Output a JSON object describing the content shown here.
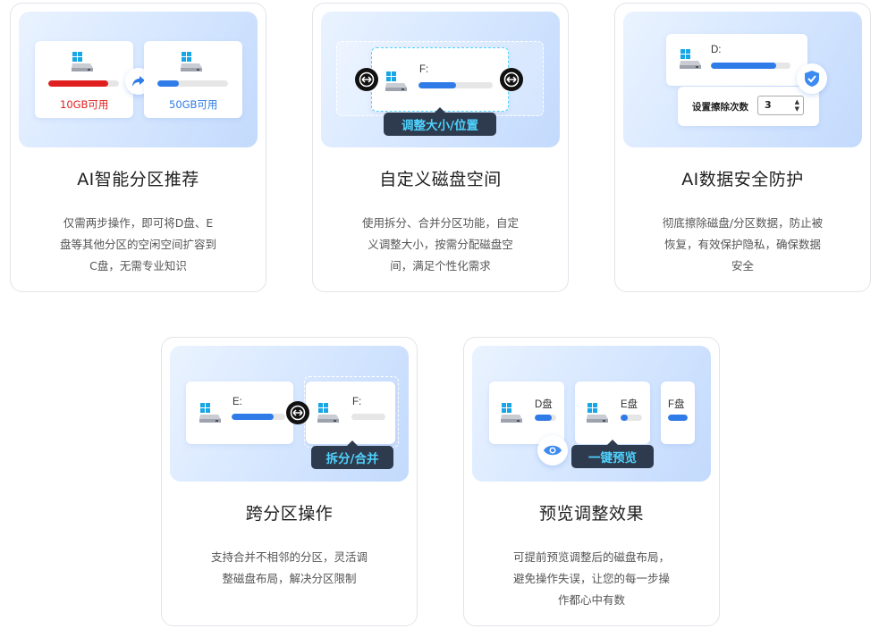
{
  "cards": [
    {
      "title": "AI智能分区推荐",
      "desc": "仅需两步操作，即可将D盘、E盘等其他分区的空闲空间扩容到C盘，无需专业知识",
      "left_caption": "10GB可用",
      "right_caption": "50GB可用",
      "left_fill": 0.85,
      "right_fill": 0.3
    },
    {
      "title": "自定义磁盘空间",
      "desc": "使用拆分、合并分区功能，自定义调整大小，按需分配磁盘空间，满足个性化需求",
      "drive_label": "F:",
      "tag": "调整大小/位置",
      "fill": 0.5
    },
    {
      "title": "AI数据安全防护",
      "desc": "彻底擦除磁盘/分区数据，防止被恢复，有效保护隐私，确保数据安全",
      "drive_label": "D:",
      "fill": 0.82,
      "setting_label": "设置擦除次数",
      "setting_value": "3"
    },
    {
      "title": "跨分区操作",
      "desc": "支持合并不相邻的分区，灵活调整磁盘布局，解决分区限制",
      "left_label": "E:",
      "right_label": "F:",
      "tag": "拆分/合并",
      "left_fill": 0.78
    },
    {
      "title": "预览调整效果",
      "desc": "可提前预览调整后的磁盘布局，避免操作失误，让您的每一步操作都心中有数",
      "drives": [
        "D盘",
        "E盘",
        "F盘"
      ],
      "tag": "一键预览"
    }
  ],
  "colors": {
    "accent": "#2f7be8",
    "red": "#e02020",
    "tag_bg": "#2e3a4d",
    "tag_text": "#4fd3ff"
  }
}
